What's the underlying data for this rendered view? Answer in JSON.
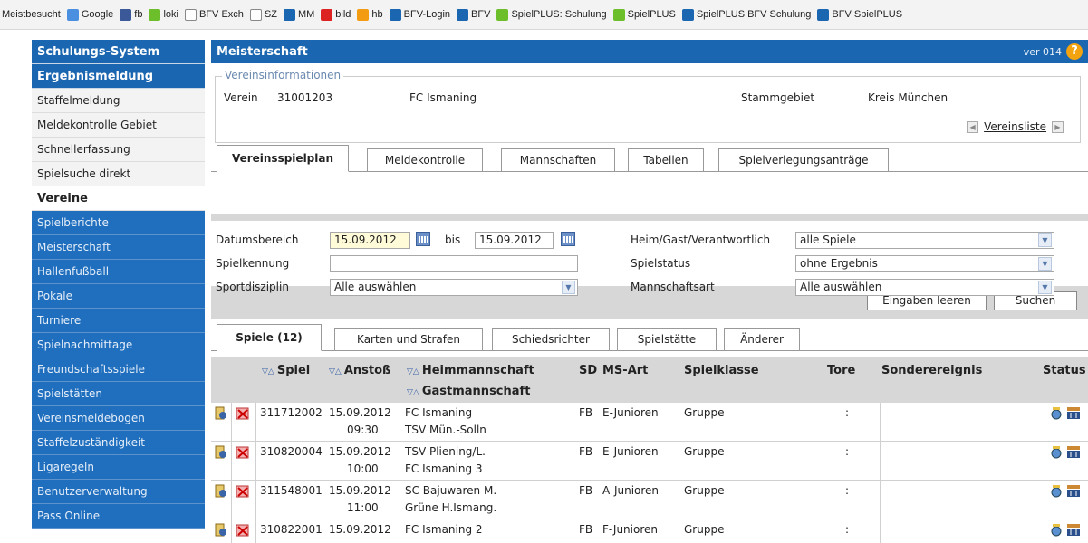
{
  "bookmarks": [
    {
      "label": "Meistbesucht",
      "color": "#f0f0f0"
    },
    {
      "label": "Google",
      "color": "#4a8fe0"
    },
    {
      "label": "fb",
      "color": "#3b5998"
    },
    {
      "label": "loki",
      "color": "#6cbf2a"
    },
    {
      "label": "BFV Exch",
      "color": "#ffffff"
    },
    {
      "label": "SZ",
      "color": "#ffffff"
    },
    {
      "label": "MM",
      "color": "#1b66b0"
    },
    {
      "label": "bild",
      "color": "#d22"
    },
    {
      "label": "hb",
      "color": "#f39c12"
    },
    {
      "label": "BFV-Login",
      "color": "#1b66b0"
    },
    {
      "label": "BFV",
      "color": "#1b66b0"
    },
    {
      "label": "SpielPLUS: Schulung",
      "color": "#6cbf2a"
    },
    {
      "label": "SpielPLUS",
      "color": "#6cbf2a"
    },
    {
      "label": "SpielPLUS BFV Schulung",
      "color": "#1b66b0"
    },
    {
      "label": "BFV SpielPLUS",
      "color": "#1b66b0"
    }
  ],
  "sidebar": {
    "items": [
      {
        "label": "Schulungs-System",
        "kind": "header"
      },
      {
        "label": "Ergebnismeldung",
        "kind": "header"
      },
      {
        "label": "Staffelmeldung",
        "kind": "sub"
      },
      {
        "label": "Meldekontrolle Gebiet",
        "kind": "sub"
      },
      {
        "label": "Schnellerfassung",
        "kind": "sub"
      },
      {
        "label": "Spielsuche direkt",
        "kind": "sub"
      },
      {
        "label": "Vereine",
        "kind": "section"
      },
      {
        "label": "Spielberichte",
        "kind": "blue"
      },
      {
        "label": "Meisterschaft",
        "kind": "blue"
      },
      {
        "label": "Hallenfußball",
        "kind": "blue"
      },
      {
        "label": "Pokale",
        "kind": "blue"
      },
      {
        "label": "Turniere",
        "kind": "blue"
      },
      {
        "label": "Spielnachmittage",
        "kind": "blue"
      },
      {
        "label": "Freundschaftsspiele",
        "kind": "blue"
      },
      {
        "label": "Spielstätten",
        "kind": "blue"
      },
      {
        "label": "Vereinsmeldebogen",
        "kind": "blue"
      },
      {
        "label": "Staffelzuständigkeit",
        "kind": "blue"
      },
      {
        "label": "Ligaregeln",
        "kind": "blue"
      },
      {
        "label": "Benutzerverwaltung",
        "kind": "blue"
      },
      {
        "label": "Pass Online",
        "kind": "blue"
      }
    ]
  },
  "main": {
    "title": "Meisterschaft",
    "version": "ver 014",
    "help_icon": "help-icon",
    "vereinsinfo": {
      "legend": "Vereinsinformationen",
      "verein_label": "Verein",
      "verein_nr": "31001203",
      "verein_name": "FC Ismaning",
      "stammgebiet_label": "Stammgebiet",
      "stammgebiet_value": "Kreis München",
      "vereinsliste_link": "Vereinsliste"
    },
    "tabs": [
      {
        "label": "Vereinsspielplan",
        "active": true
      },
      {
        "label": "Meldekontrolle",
        "active": false
      },
      {
        "label": "Mannschaften",
        "active": false
      },
      {
        "label": "Tabellen",
        "active": false
      },
      {
        "label": "Spielverlegungsanträge",
        "active": false
      }
    ],
    "filter": {
      "datumsbereich_label": "Datumsbereich",
      "date_from": "15.09.2012",
      "bis_label": "bis",
      "date_to": "15.09.2012",
      "spielkennung_label": "Spielkennung",
      "spielkennung_value": "",
      "sportdisziplin_label": "Sportdisziplin",
      "sportdisziplin_value": "Alle auswählen",
      "heimgast_label": "Heim/Gast/Verantwortlich",
      "heimgast_value": "alle Spiele",
      "spielstatus_label": "Spielstatus",
      "spielstatus_value": "ohne Ergebnis",
      "mannschaftsart_label": "Mannschaftsart",
      "mannschaftsart_value": "Alle auswählen",
      "clear_button": "Eingaben leeren",
      "search_button": "Suchen"
    },
    "result_tabs": [
      {
        "label": "Spiele (12)",
        "active": true
      },
      {
        "label": "Karten und Strafen",
        "active": false
      },
      {
        "label": "Schiedsrichter",
        "active": false
      },
      {
        "label": "Spielstätte",
        "active": false
      },
      {
        "label": "Änderer",
        "active": false
      }
    ],
    "table": {
      "sort_glyph": "▽△",
      "columns": {
        "spiel": "Spiel",
        "anstoss": "Anstoß",
        "heim": "Heimmannschaft",
        "gast": "Gastmannschaft",
        "sd": "SD",
        "msart": "MS-Art",
        "spielklasse": "Spielklasse",
        "tore": "Tore",
        "sonder": "Sonderereignis",
        "status": "Status"
      },
      "rows": [
        {
          "spiel": "311712002",
          "date": "15.09.2012",
          "time": "09:30",
          "heim": "FC Ismaning",
          "gast": "TSV Mün.-Solln",
          "sd": "FB",
          "msart": "E-Junioren",
          "klasse": "Gruppe",
          "tore": ":"
        },
        {
          "spiel": "310820004",
          "date": "15.09.2012",
          "time": "10:00",
          "heim": "TSV Pliening/L.",
          "gast": "FC Ismaning 3",
          "sd": "FB",
          "msart": "E-Junioren",
          "klasse": "Gruppe",
          "tore": ":"
        },
        {
          "spiel": "311548001",
          "date": "15.09.2012",
          "time": "11:00",
          "heim": "SC Bajuwaren M.",
          "gast": "Grüne H.Ismang.",
          "sd": "FB",
          "msart": "A-Junioren",
          "klasse": "Gruppe",
          "tore": ":"
        },
        {
          "spiel": "310822001",
          "date": "15.09.2012",
          "time": "",
          "heim": "FC Ismaning 2",
          "gast": "",
          "sd": "FB",
          "msart": "F-Junioren",
          "klasse": "Gruppe",
          "tore": ":"
        }
      ]
    }
  }
}
